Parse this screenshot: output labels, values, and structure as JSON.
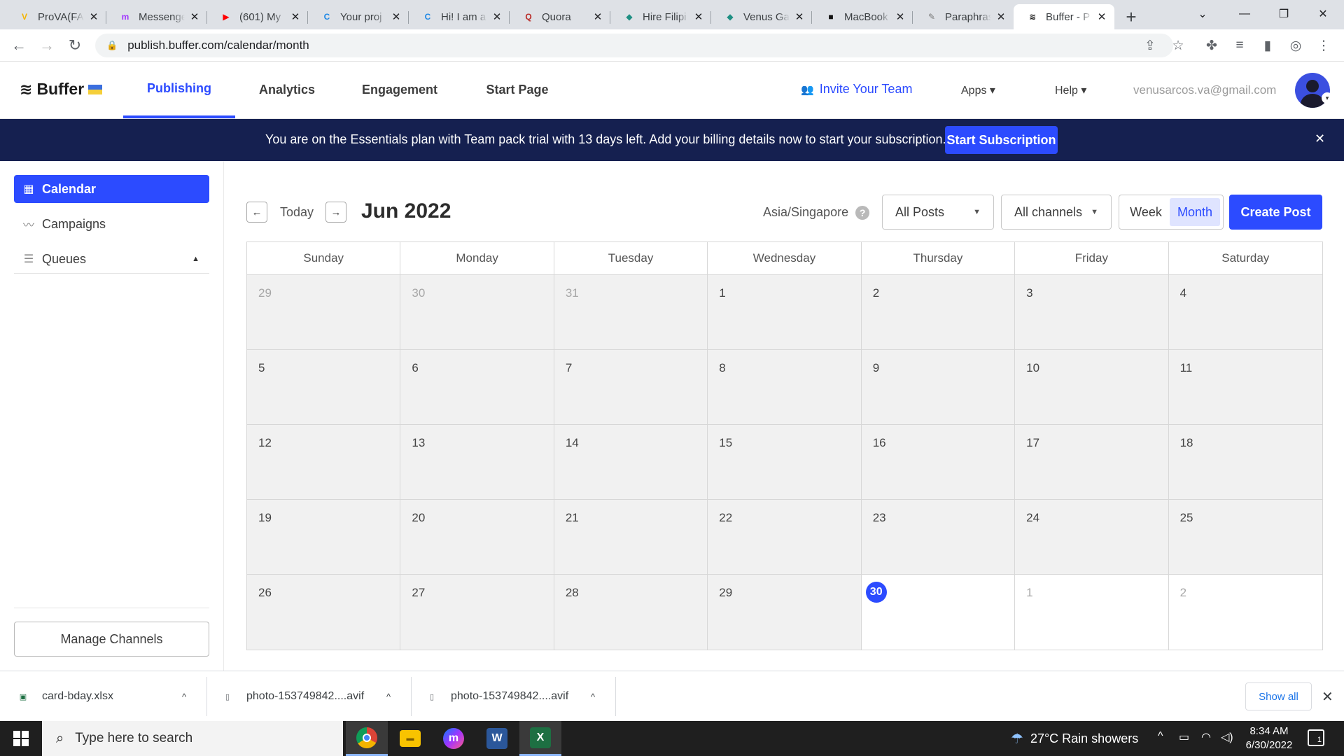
{
  "browser": {
    "tabs": [
      {
        "title": "ProVA(FA",
        "icon": "prova-icon",
        "color": "#f4b400",
        "glyph": "V"
      },
      {
        "title": "Messenger",
        "icon": "messenger-icon",
        "color": "#a033ff",
        "glyph": "m"
      },
      {
        "title": "(601) My",
        "icon": "youtube-icon",
        "color": "#ff0000",
        "glyph": "▶"
      },
      {
        "title": "Your proj",
        "icon": "circle-c-icon",
        "color": "#1e88e5",
        "glyph": "C"
      },
      {
        "title": "Hi! I am a",
        "icon": "circle-c-icon",
        "color": "#1e88e5",
        "glyph": "C"
      },
      {
        "title": "Quora",
        "icon": "quora-icon",
        "color": "#b92b27",
        "glyph": "Q"
      },
      {
        "title": "Hire Filipi",
        "icon": "onlinejobs-icon",
        "color": "#1f8f83",
        "glyph": "◆"
      },
      {
        "title": "Venus Ga",
        "icon": "onlinejobs-icon",
        "color": "#1f8f83",
        "glyph": "◆"
      },
      {
        "title": "MacBook",
        "icon": "macbook-icon",
        "color": "#111111",
        "glyph": "■"
      },
      {
        "title": "Paraphras",
        "icon": "quill-icon",
        "color": "#777777",
        "glyph": "✎"
      },
      {
        "title": "Buffer - P",
        "icon": "buffer-icon",
        "color": "#111111",
        "glyph": "≋"
      }
    ],
    "active_tab_index": 10,
    "url": "publish.buffer.com/calendar/month"
  },
  "app": {
    "brand": "Buffer",
    "nav": [
      {
        "label": "Publishing",
        "active": true
      },
      {
        "label": "Analytics",
        "active": false
      },
      {
        "label": "Engagement",
        "active": false
      },
      {
        "label": "Start Page",
        "active": false
      }
    ],
    "invite_label": "Invite Your Team",
    "apps_label": "Apps",
    "help_label": "Help",
    "user_email": "venusarcos.va@gmail.com"
  },
  "banner": {
    "message": "You are on the Essentials plan with Team pack trial with 13 days left. Add your billing details now to start your subscription.",
    "button_label": "Start Subscription",
    "close_glyph": "✕"
  },
  "sidebar": {
    "items": [
      {
        "label": "Calendar",
        "icon": "calendar-icon",
        "active": true
      },
      {
        "label": "Campaigns",
        "icon": "trend-line-icon",
        "active": false
      },
      {
        "label": "Queues",
        "icon": "list-icon",
        "active": false
      }
    ],
    "manage_label": "Manage Channels"
  },
  "calendar": {
    "today_label": "Today",
    "month_title": "Jun 2022",
    "timezone": "Asia/Singapore",
    "posts_filter": "All Posts",
    "channels_filter": "All channels",
    "view_week": "Week",
    "view_month": "Month",
    "selected_view": "Month",
    "create_label": "Create Post",
    "weekdays": [
      "Sunday",
      "Monday",
      "Tuesday",
      "Wednesday",
      "Thursday",
      "Friday",
      "Saturday"
    ],
    "days": [
      {
        "n": "29",
        "other": true
      },
      {
        "n": "30",
        "other": true
      },
      {
        "n": "31",
        "other": true
      },
      {
        "n": "1"
      },
      {
        "n": "2"
      },
      {
        "n": "3"
      },
      {
        "n": "4"
      },
      {
        "n": "5"
      },
      {
        "n": "6"
      },
      {
        "n": "7"
      },
      {
        "n": "8"
      },
      {
        "n": "9"
      },
      {
        "n": "10"
      },
      {
        "n": "11"
      },
      {
        "n": "12"
      },
      {
        "n": "13"
      },
      {
        "n": "14"
      },
      {
        "n": "15"
      },
      {
        "n": "16"
      },
      {
        "n": "17"
      },
      {
        "n": "18"
      },
      {
        "n": "19"
      },
      {
        "n": "20"
      },
      {
        "n": "21"
      },
      {
        "n": "22"
      },
      {
        "n": "23"
      },
      {
        "n": "24"
      },
      {
        "n": "25"
      },
      {
        "n": "26"
      },
      {
        "n": "27"
      },
      {
        "n": "28"
      },
      {
        "n": "29"
      },
      {
        "n": "30",
        "today": true
      },
      {
        "n": "1",
        "other": true,
        "future": true
      },
      {
        "n": "2",
        "other": true,
        "future": true
      }
    ]
  },
  "downloads": {
    "items": [
      {
        "name": "card-bday.xlsx",
        "icon": "excel-file-icon"
      },
      {
        "name": "photo-153749842....avif",
        "icon": "file-icon"
      },
      {
        "name": "photo-153749842....avif",
        "icon": "file-icon"
      }
    ],
    "show_all_label": "Show all"
  },
  "taskbar": {
    "search_placeholder": "Type here to search",
    "weather": "27°C  Rain showers",
    "time": "8:34 AM",
    "date": "6/30/2022",
    "notification_count": "1"
  },
  "colors": {
    "accent": "#2c4bff",
    "banner_bg": "#152050",
    "past_day_bg": "#f1f1f1"
  }
}
